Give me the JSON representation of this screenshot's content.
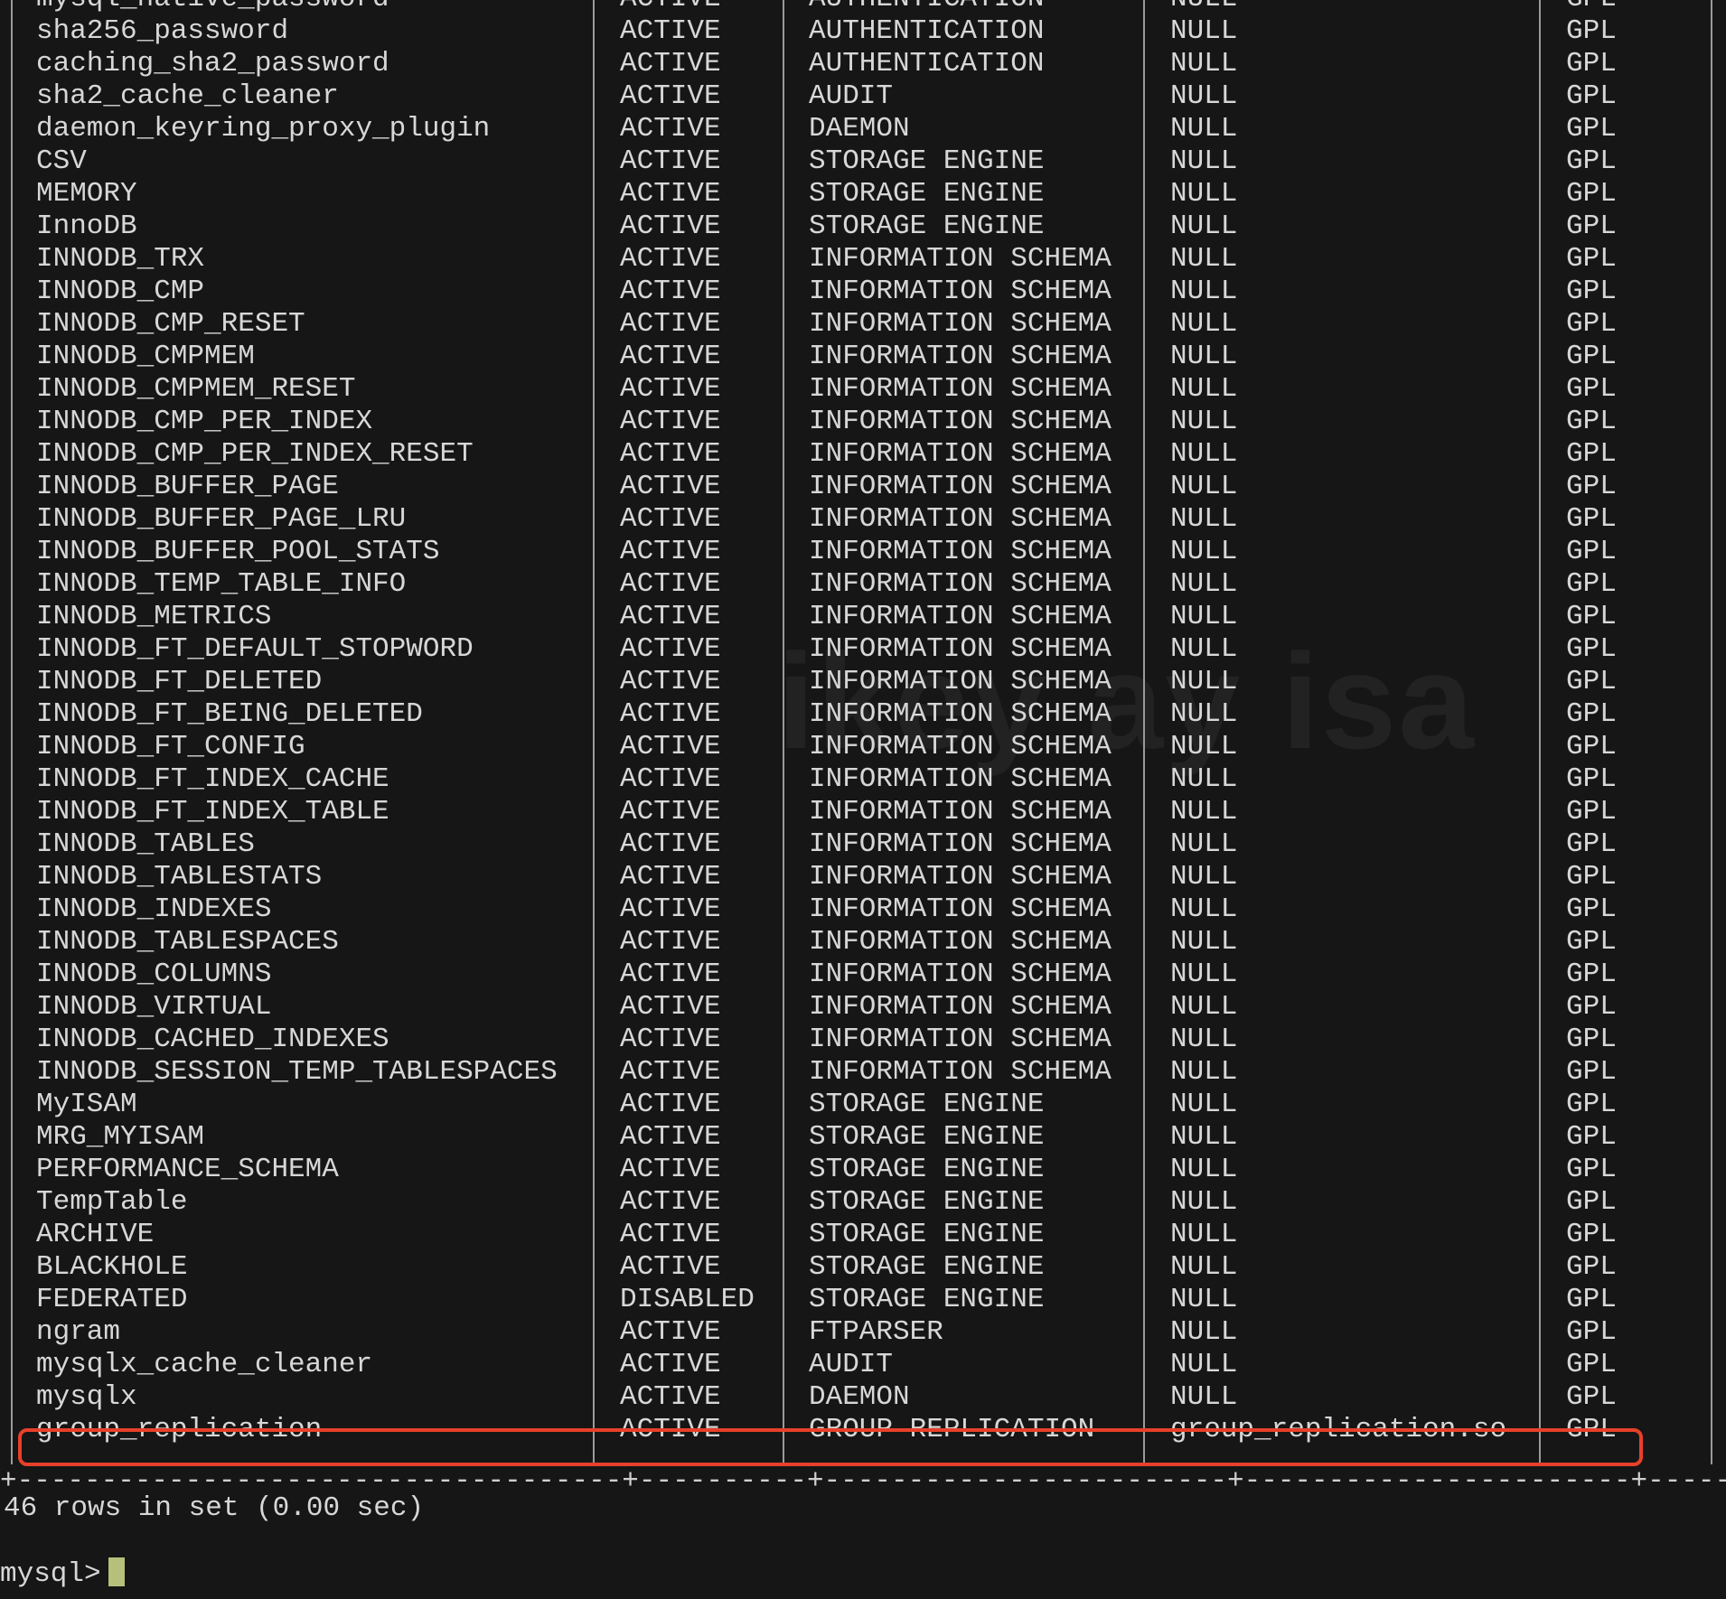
{
  "watermark": "ikey ay isa",
  "table": {
    "rows": [
      [
        "mysql_native_password",
        "ACTIVE",
        "AUTHENTICATION",
        "NULL",
        "GPL"
      ],
      [
        "sha256_password",
        "ACTIVE",
        "AUTHENTICATION",
        "NULL",
        "GPL"
      ],
      [
        "caching_sha2_password",
        "ACTIVE",
        "AUTHENTICATION",
        "NULL",
        "GPL"
      ],
      [
        "sha2_cache_cleaner",
        "ACTIVE",
        "AUDIT",
        "NULL",
        "GPL"
      ],
      [
        "daemon_keyring_proxy_plugin",
        "ACTIVE",
        "DAEMON",
        "NULL",
        "GPL"
      ],
      [
        "CSV",
        "ACTIVE",
        "STORAGE ENGINE",
        "NULL",
        "GPL"
      ],
      [
        "MEMORY",
        "ACTIVE",
        "STORAGE ENGINE",
        "NULL",
        "GPL"
      ],
      [
        "InnoDB",
        "ACTIVE",
        "STORAGE ENGINE",
        "NULL",
        "GPL"
      ],
      [
        "INNODB_TRX",
        "ACTIVE",
        "INFORMATION SCHEMA",
        "NULL",
        "GPL"
      ],
      [
        "INNODB_CMP",
        "ACTIVE",
        "INFORMATION SCHEMA",
        "NULL",
        "GPL"
      ],
      [
        "INNODB_CMP_RESET",
        "ACTIVE",
        "INFORMATION SCHEMA",
        "NULL",
        "GPL"
      ],
      [
        "INNODB_CMPMEM",
        "ACTIVE",
        "INFORMATION SCHEMA",
        "NULL",
        "GPL"
      ],
      [
        "INNODB_CMPMEM_RESET",
        "ACTIVE",
        "INFORMATION SCHEMA",
        "NULL",
        "GPL"
      ],
      [
        "INNODB_CMP_PER_INDEX",
        "ACTIVE",
        "INFORMATION SCHEMA",
        "NULL",
        "GPL"
      ],
      [
        "INNODB_CMP_PER_INDEX_RESET",
        "ACTIVE",
        "INFORMATION SCHEMA",
        "NULL",
        "GPL"
      ],
      [
        "INNODB_BUFFER_PAGE",
        "ACTIVE",
        "INFORMATION SCHEMA",
        "NULL",
        "GPL"
      ],
      [
        "INNODB_BUFFER_PAGE_LRU",
        "ACTIVE",
        "INFORMATION SCHEMA",
        "NULL",
        "GPL"
      ],
      [
        "INNODB_BUFFER_POOL_STATS",
        "ACTIVE",
        "INFORMATION SCHEMA",
        "NULL",
        "GPL"
      ],
      [
        "INNODB_TEMP_TABLE_INFO",
        "ACTIVE",
        "INFORMATION SCHEMA",
        "NULL",
        "GPL"
      ],
      [
        "INNODB_METRICS",
        "ACTIVE",
        "INFORMATION SCHEMA",
        "NULL",
        "GPL"
      ],
      [
        "INNODB_FT_DEFAULT_STOPWORD",
        "ACTIVE",
        "INFORMATION SCHEMA",
        "NULL",
        "GPL"
      ],
      [
        "INNODB_FT_DELETED",
        "ACTIVE",
        "INFORMATION SCHEMA",
        "NULL",
        "GPL"
      ],
      [
        "INNODB_FT_BEING_DELETED",
        "ACTIVE",
        "INFORMATION SCHEMA",
        "NULL",
        "GPL"
      ],
      [
        "INNODB_FT_CONFIG",
        "ACTIVE",
        "INFORMATION SCHEMA",
        "NULL",
        "GPL"
      ],
      [
        "INNODB_FT_INDEX_CACHE",
        "ACTIVE",
        "INFORMATION SCHEMA",
        "NULL",
        "GPL"
      ],
      [
        "INNODB_FT_INDEX_TABLE",
        "ACTIVE",
        "INFORMATION SCHEMA",
        "NULL",
        "GPL"
      ],
      [
        "INNODB_TABLES",
        "ACTIVE",
        "INFORMATION SCHEMA",
        "NULL",
        "GPL"
      ],
      [
        "INNODB_TABLESTATS",
        "ACTIVE",
        "INFORMATION SCHEMA",
        "NULL",
        "GPL"
      ],
      [
        "INNODB_INDEXES",
        "ACTIVE",
        "INFORMATION SCHEMA",
        "NULL",
        "GPL"
      ],
      [
        "INNODB_TABLESPACES",
        "ACTIVE",
        "INFORMATION SCHEMA",
        "NULL",
        "GPL"
      ],
      [
        "INNODB_COLUMNS",
        "ACTIVE",
        "INFORMATION SCHEMA",
        "NULL",
        "GPL"
      ],
      [
        "INNODB_VIRTUAL",
        "ACTIVE",
        "INFORMATION SCHEMA",
        "NULL",
        "GPL"
      ],
      [
        "INNODB_CACHED_INDEXES",
        "ACTIVE",
        "INFORMATION SCHEMA",
        "NULL",
        "GPL"
      ],
      [
        "INNODB_SESSION_TEMP_TABLESPACES",
        "ACTIVE",
        "INFORMATION SCHEMA",
        "NULL",
        "GPL"
      ],
      [
        "MyISAM",
        "ACTIVE",
        "STORAGE ENGINE",
        "NULL",
        "GPL"
      ],
      [
        "MRG_MYISAM",
        "ACTIVE",
        "STORAGE ENGINE",
        "NULL",
        "GPL"
      ],
      [
        "PERFORMANCE_SCHEMA",
        "ACTIVE",
        "STORAGE ENGINE",
        "NULL",
        "GPL"
      ],
      [
        "TempTable",
        "ACTIVE",
        "STORAGE ENGINE",
        "NULL",
        "GPL"
      ],
      [
        "ARCHIVE",
        "ACTIVE",
        "STORAGE ENGINE",
        "NULL",
        "GPL"
      ],
      [
        "BLACKHOLE",
        "ACTIVE",
        "STORAGE ENGINE",
        "NULL",
        "GPL"
      ],
      [
        "FEDERATED",
        "DISABLED",
        "STORAGE ENGINE",
        "NULL",
        "GPL"
      ],
      [
        "ngram",
        "ACTIVE",
        "FTPARSER",
        "NULL",
        "GPL"
      ],
      [
        "mysqlx_cache_cleaner",
        "ACTIVE",
        "AUDIT",
        "NULL",
        "GPL"
      ],
      [
        "mysqlx",
        "ACTIVE",
        "DAEMON",
        "NULL",
        "GPL"
      ],
      [
        "group_replication",
        "ACTIVE",
        "GROUP REPLICATION",
        "group_replication.so",
        "GPL"
      ]
    ],
    "highlighted_row": "group_replication",
    "highlight_color": "#e8402a"
  },
  "border_line": "+------------------------------------+----------+------------------------+-----------------------+-----------+",
  "summary": "46 rows in set (0.00 sec)",
  "prompt": "mysql>",
  "colors": {
    "background": "#161616",
    "text": "#d7d7d7",
    "cursor": "#b7c07a"
  }
}
